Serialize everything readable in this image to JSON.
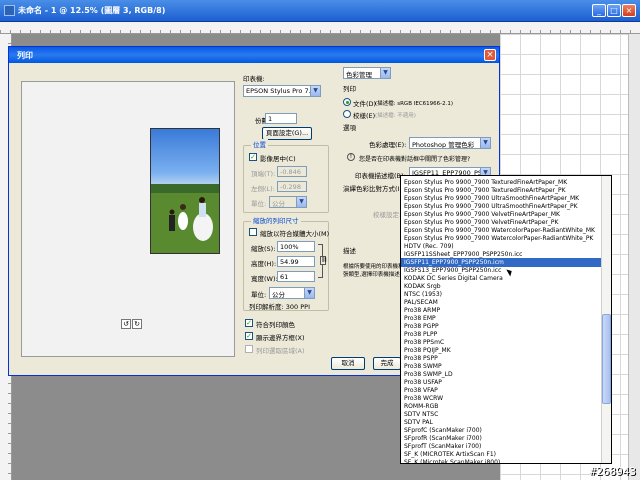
{
  "app": {
    "title": "未命名 - 1 @ 12.5% (圖層 3, RGB/8)",
    "win_buttons": [
      "_",
      "□",
      "×"
    ]
  },
  "dialog": {
    "title": "列印",
    "close": "×",
    "printer_label": "印表機:",
    "printer_value": "EPSON Stylus Pro 7...",
    "copies_label": "份數:",
    "copies_value": "1",
    "page_setup_button": "頁面設定(G)...",
    "position": {
      "group_title": "位置",
      "center_image_label": "影像居中(C)",
      "center_image_checked": true,
      "top_label": "頂端(T):",
      "top_value": "-0.846",
      "left_label": "左側(L):",
      "left_value": "-0.298",
      "unit_value": "公分",
      "unit_label": "單位:"
    },
    "scaled": {
      "group_title": "縮放的列印尺寸",
      "fit_media_label": "縮放以符合媒體大小(M)",
      "fit_media_checked": false,
      "scale_label": "縮放(S):",
      "scale_value": "100%",
      "height_label": "高度(H):",
      "height_value": "54.99",
      "width_label": "寬度(W):",
      "width_value": "61",
      "unit_label": "單位:",
      "unit_value": "公分",
      "resolution": "列印解析度: 300 PPI"
    },
    "match_colors_label": "符合列印顏色",
    "match_colors_checked": true,
    "bounding_box_label": "顯示邊界方框(X)",
    "bounding_box_checked": true,
    "print_selection_label": "列印選取區域(A)",
    "print_selection_checked": false,
    "cancel_button": "取消",
    "done_button": "完成",
    "color_mgmt_dropdown": "色彩管理",
    "print_section_label": "列印",
    "doc_radio_label": "文件(D)",
    "doc_profile": "(描述檔: sRGB IEC61966-2.1)",
    "proof_radio_label": "校樣(E)",
    "proof_profile": "(描述檔: 不適用)",
    "options_label": "選項",
    "color_handling_label": "色彩處理(E):",
    "color_handling_value": "Photoshop 管理色彩",
    "warning_text": "您是否在印表機對話框中關閉了色彩管理?",
    "printer_profile_label": "印表機描述檔(B):",
    "printer_profile_value": "IGSFP11_EPP7900_PSP...",
    "rendering_label": "演繹色彩比對方式(I):",
    "proof_setup_label": "校樣設定:",
    "description_label": "描述",
    "description_text": "根據所要使用的印表機和紙張類型,選擇印表機描述檔。"
  },
  "dropdown": {
    "selected_index": 10,
    "items": [
      "Epson Stylus Pro 9900_7900 TexturedFineArtPaper_MK",
      "Epson Stylus Pro 9900_7900 TexturedFineArtPaper_PK",
      "Epson Stylus Pro 9900_7900 UltraSmoothFineArtPaper_MK",
      "Epson Stylus Pro 9900_7900 UltraSmoothFineArtPaper_PK",
      "Epson Stylus Pro 9900_7900 VelvetFineArtPaper_MK",
      "Epson Stylus Pro 9900_7900 VelvetFineArtPaper_PK",
      "Epson Stylus Pro 9900_7900 WatercolorPaper-RadiantWhite_MK",
      "Epson Stylus Pro 9900_7900 WatercolorPaper-RadiantWhite_PK",
      "HDTV (Rec. 709)",
      "IGSFP11SSheet_EPP7900_PSPP250n.icc",
      "IGSFP11_EPP7900_PSPP250n.icm",
      "IGSFS13_EPP7900_PSPP250n.icc",
      "KODAK DC Series Digital Camera",
      "KODAK Srgb",
      "NTSC (1953)",
      "PAL/SECAM",
      "Pro38 ARMP",
      "Pro38 EMP",
      "Pro38 PGPP",
      "Pro38 PLPP",
      "Pro38 PPSmC",
      "Pro38 PQIJP_MK",
      "Pro38 PSPP",
      "Pro38 SWMP",
      "Pro38 SWMP_LD",
      "Pro38 USFAP",
      "Pro38 VFAP",
      "Pro38 WCRW",
      "ROMM-RGB",
      "SDTV NTSC",
      "SDTV PAL",
      "SFprofC (ScanMaker i700)",
      "SFprofR (ScanMaker i700)",
      "SFprofT (ScanMaker i700)",
      "SF_K (MICROTEK ArtixScan F1)",
      "SF_K (Microtek ScanMaker i800)"
    ]
  },
  "watermark": "#268943",
  "colors": {
    "titlebar": "#1c5fd0",
    "dialog_bg": "#ece9d8",
    "selection": "#316ac5",
    "group_title": "#0046d5"
  }
}
